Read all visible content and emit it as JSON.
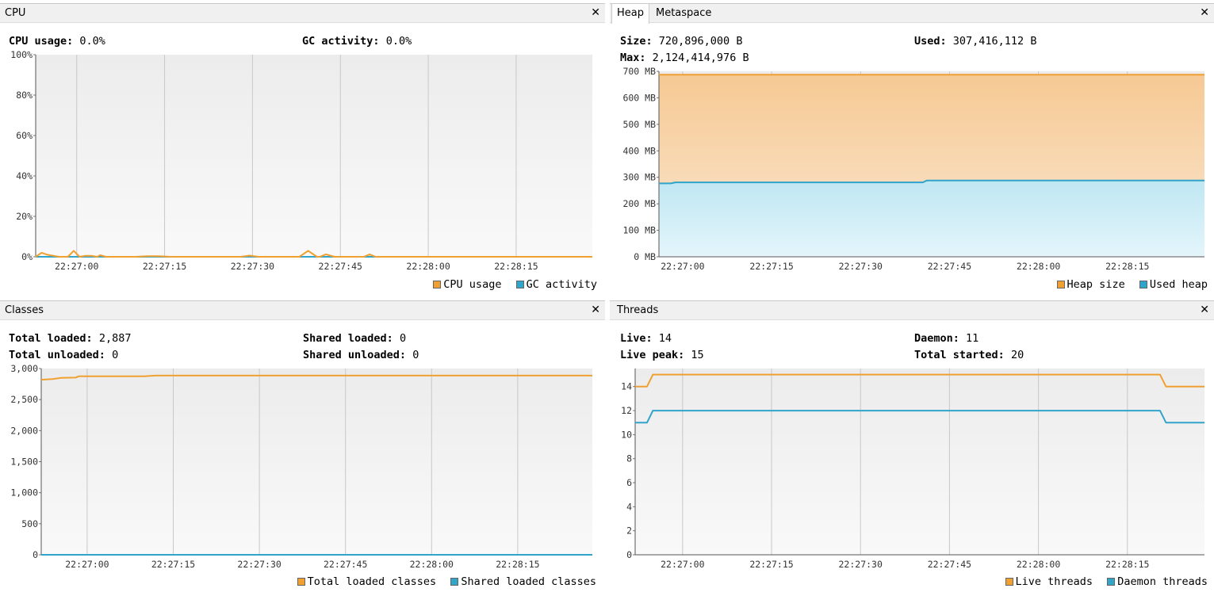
{
  "colors": {
    "orange": "#f0a030",
    "blue": "#31a4cc",
    "orange_fill_top": "#f6c993",
    "orange_fill_bottom": "#fbe7d2",
    "blue_fill_top": "#bfe7f3",
    "blue_fill_bottom": "#e4f5fb",
    "plot_bg_top": "#ececec",
    "plot_bg_bottom": "#f9f9f9",
    "grid": "#c8c8c8"
  },
  "cpu": {
    "title": "CPU",
    "close_icon": "close-icon",
    "cpu_usage_label": "CPU usage:",
    "cpu_usage_value": "0.0%",
    "gc_label": "GC activity:",
    "gc_value": "0.0%",
    "legend": [
      "CPU usage",
      "GC activity"
    ]
  },
  "heap": {
    "tabs": [
      "Heap",
      "Metaspace"
    ],
    "active_tab": "Heap",
    "close_icon": "close-icon",
    "size_label": "Size:",
    "size_value": "720,896,000 B",
    "used_label": "Used:",
    "used_value": "307,416,112 B",
    "max_label": "Max:",
    "max_value": "2,124,414,976 B",
    "legend": [
      "Heap size",
      "Used heap"
    ]
  },
  "classes": {
    "title": "Classes",
    "close_icon": "close-icon",
    "total_loaded_label": "Total loaded:",
    "total_loaded_value": "2,887",
    "total_unloaded_label": "Total unloaded:",
    "total_unloaded_value": "0",
    "shared_loaded_label": "Shared loaded:",
    "shared_loaded_value": "0",
    "shared_unloaded_label": "Shared unloaded:",
    "shared_unloaded_value": "0",
    "legend": [
      "Total loaded classes",
      "Shared loaded classes"
    ]
  },
  "threads": {
    "title": "Threads",
    "close_icon": "close-icon",
    "live_label": "Live:",
    "live_value": "14",
    "daemon_label": "Daemon:",
    "daemon_value": "11",
    "live_peak_label": "Live peak:",
    "live_peak_value": "15",
    "total_started_label": "Total started:",
    "total_started_value": "20",
    "legend": [
      "Live threads",
      "Daemon threads"
    ]
  },
  "chart_data": [
    {
      "id": "cpu",
      "type": "line",
      "x_ticks": [
        "22:27:00",
        "22:27:15",
        "22:27:30",
        "22:27:45",
        "22:28:00",
        "22:28:15"
      ],
      "x_tick_seconds": [
        0,
        15,
        30,
        45,
        60,
        75
      ],
      "xlim_seconds": [
        -7,
        88
      ],
      "y_ticks": [
        "0%",
        "20%",
        "40%",
        "60%",
        "80%",
        "100%"
      ],
      "y_tick_values": [
        0,
        20,
        40,
        60,
        80,
        100
      ],
      "ylim": [
        0,
        100
      ],
      "series": [
        {
          "name": "CPU usage",
          "color": "#f0a030",
          "points": [
            [
              -7,
              0
            ],
            [
              -6,
              2
            ],
            [
              -5,
              1
            ],
            [
              -4,
              0.5
            ],
            [
              -3,
              0
            ],
            [
              -1.5,
              0
            ],
            [
              -0.5,
              3
            ],
            [
              0.5,
              0
            ],
            [
              1.5,
              0.5
            ],
            [
              2.5,
              0.5
            ],
            [
              3.5,
              0
            ],
            [
              4,
              0.8
            ],
            [
              5,
              0
            ],
            [
              10,
              0
            ],
            [
              12,
              0.3
            ],
            [
              14,
              0.3
            ],
            [
              16,
              0
            ],
            [
              28,
              0
            ],
            [
              29.5,
              0.6
            ],
            [
              31,
              0
            ],
            [
              38,
              0
            ],
            [
              39.5,
              3
            ],
            [
              41,
              0
            ],
            [
              41.5,
              0
            ],
            [
              42.5,
              1.2
            ],
            [
              44,
              0
            ],
            [
              49,
              0
            ],
            [
              50,
              1.2
            ],
            [
              51,
              0
            ],
            [
              88,
              0
            ]
          ]
        },
        {
          "name": "GC activity",
          "color": "#31a4cc",
          "points": [
            [
              -7,
              0
            ],
            [
              88,
              0
            ]
          ]
        }
      ]
    },
    {
      "id": "heap",
      "type": "area",
      "x_ticks": [
        "22:27:00",
        "22:27:15",
        "22:27:30",
        "22:27:45",
        "22:28:00",
        "22:28:15"
      ],
      "x_tick_seconds": [
        0,
        15,
        30,
        45,
        60,
        75
      ],
      "xlim_seconds": [
        -4,
        88
      ],
      "y_ticks": [
        "0 MB",
        "100 MB",
        "200 MB",
        "300 MB",
        "400 MB",
        "500 MB",
        "600 MB",
        "700 MB"
      ],
      "y_tick_values": [
        0,
        100,
        200,
        300,
        400,
        500,
        600,
        700
      ],
      "ylim": [
        0,
        700
      ],
      "series": [
        {
          "name": "Heap size",
          "color": "#f0a030",
          "points": [
            [
              -4,
              687.5
            ],
            [
              88,
              687.5
            ]
          ]
        },
        {
          "name": "Used heap",
          "color": "#31a4cc",
          "points": [
            [
              -4,
              277
            ],
            [
              -2,
              277
            ],
            [
              -1.2,
              281
            ],
            [
              20,
              281
            ],
            [
              40.5,
              281
            ],
            [
              41.2,
              288
            ],
            [
              88,
              288
            ]
          ]
        }
      ]
    },
    {
      "id": "classes",
      "type": "line",
      "x_ticks": [
        "22:27:00",
        "22:27:15",
        "22:27:30",
        "22:27:45",
        "22:28:00",
        "22:28:15"
      ],
      "x_tick_seconds": [
        0,
        15,
        30,
        45,
        60,
        75
      ],
      "xlim_seconds": [
        -8,
        88
      ],
      "y_ticks": [
        "0",
        "500",
        "1,000",
        "1,500",
        "2,000",
        "2,500",
        "3,000"
      ],
      "y_tick_values": [
        0,
        500,
        1000,
        1500,
        2000,
        2500,
        3000
      ],
      "ylim": [
        0,
        3000
      ],
      "series": [
        {
          "name": "Total loaded classes",
          "color": "#f0a030",
          "points": [
            [
              -8,
              2820
            ],
            [
              -6,
              2830
            ],
            [
              -4.5,
              2850
            ],
            [
              -2,
              2855
            ],
            [
              -1.5,
              2875
            ],
            [
              0,
              2875
            ],
            [
              8,
              2875
            ],
            [
              10,
              2875
            ],
            [
              11,
              2883
            ],
            [
              12,
              2887
            ],
            [
              88,
              2887
            ]
          ]
        },
        {
          "name": "Shared loaded classes",
          "color": "#31a4cc",
          "points": [
            [
              -8,
              0
            ],
            [
              88,
              0
            ]
          ]
        }
      ]
    },
    {
      "id": "threads",
      "type": "line",
      "x_ticks": [
        "22:27:00",
        "22:27:15",
        "22:27:30",
        "22:27:45",
        "22:28:00",
        "22:28:15"
      ],
      "x_tick_seconds": [
        0,
        15,
        30,
        45,
        60,
        75
      ],
      "xlim_seconds": [
        -8,
        88
      ],
      "y_ticks": [
        "0",
        "2",
        "4",
        "6",
        "8",
        "10",
        "12",
        "14"
      ],
      "y_tick_values": [
        0,
        2,
        4,
        6,
        8,
        10,
        12,
        14
      ],
      "ylim": [
        0,
        15.5
      ],
      "series": [
        {
          "name": "Live threads",
          "color": "#f0a030",
          "points": [
            [
              -8,
              14
            ],
            [
              -6,
              14
            ],
            [
              -5,
              15
            ],
            [
              80.5,
              15
            ],
            [
              81.5,
              14
            ],
            [
              88,
              14
            ]
          ]
        },
        {
          "name": "Daemon threads",
          "color": "#31a4cc",
          "points": [
            [
              -8,
              11
            ],
            [
              -6,
              11
            ],
            [
              -5,
              12
            ],
            [
              80.5,
              12
            ],
            [
              81.5,
              11
            ],
            [
              88,
              11
            ]
          ]
        }
      ]
    }
  ]
}
